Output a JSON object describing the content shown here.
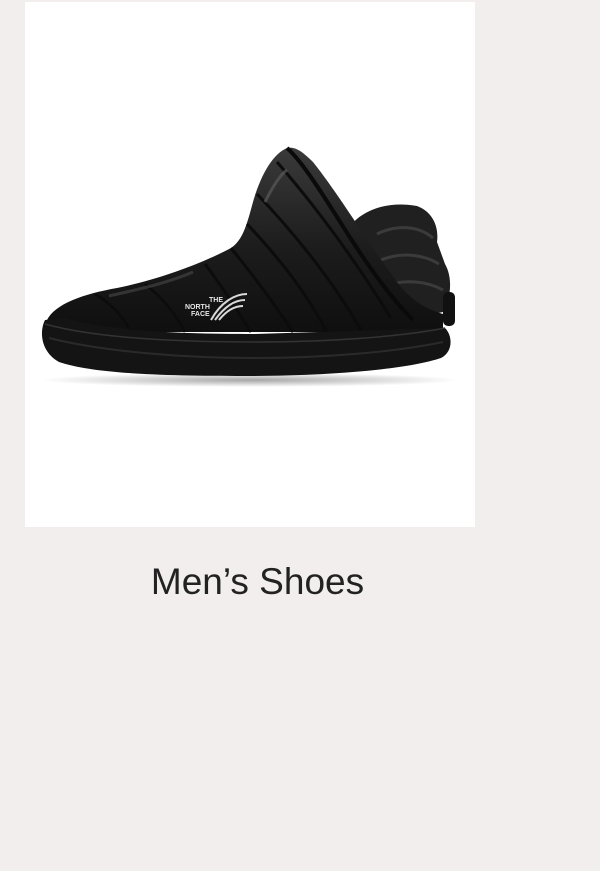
{
  "category_tile": {
    "title": "Men’s Shoes",
    "product_image": {
      "icon": "shoe-icon",
      "brand_logo_text": [
        "THE",
        "NORTH",
        "FACE"
      ]
    }
  },
  "colors": {
    "page_background": "#f1eeed",
    "image_background": "#ffffff",
    "shoe": "#1a1a1a",
    "title_text": "#222222"
  }
}
